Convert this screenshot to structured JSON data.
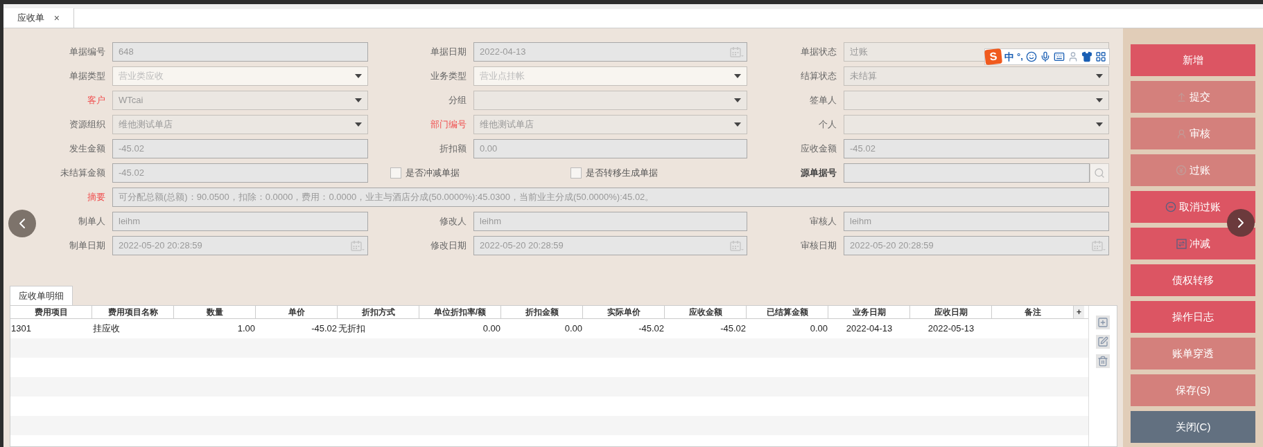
{
  "tab_bar": {
    "tabs": [
      {
        "label": "应收单",
        "selected": true,
        "close": "×"
      }
    ]
  },
  "ime_toolbar": {
    "logo": "S",
    "mode": "中",
    "punctuation": "°,"
  },
  "form": {
    "rows": [
      [
        {
          "kind": "text",
          "label": "单据编号",
          "required": false,
          "value": "648"
        },
        {
          "kind": "date",
          "label": "单据日期",
          "required": false,
          "value": "2022-04-13"
        },
        {
          "kind": "select",
          "label": "单据状态",
          "required": false,
          "editable": false,
          "value": "过账"
        }
      ],
      [
        {
          "kind": "select",
          "label": "单据类型",
          "required": false,
          "editable": true,
          "value": "营业类应收"
        },
        {
          "kind": "select",
          "label": "业务类型",
          "required": false,
          "editable": true,
          "value": "营业点挂帐"
        },
        {
          "kind": "select",
          "label": "结算状态",
          "required": false,
          "editable": false,
          "value": "未结算"
        }
      ],
      [
        {
          "kind": "select",
          "label": "客户",
          "required": true,
          "editable": false,
          "value": "WTcai"
        },
        {
          "kind": "select",
          "label": "分组",
          "required": false,
          "editable": false
        },
        {
          "kind": "select",
          "label": "签单人",
          "required": false,
          "editable": false
        }
      ],
      [
        {
          "kind": "select",
          "label": "资源组织",
          "required": false,
          "editable": false,
          "value": "维他测试单店"
        },
        {
          "kind": "select",
          "label": "部门编号",
          "required": true,
          "editable": false,
          "value": "维他测试单店"
        },
        {
          "kind": "select",
          "label": "个人",
          "required": false,
          "editable": false
        }
      ],
      [
        {
          "kind": "text",
          "label": "发生金额",
          "required": false,
          "value": "-45.02"
        },
        {
          "kind": "text",
          "label": "折扣额",
          "required": false,
          "value": "0.00"
        },
        {
          "kind": "text",
          "label": "应收金额",
          "required": false,
          "value": "-45.02"
        }
      ],
      [
        {
          "kind": "text",
          "label": "未结算金额",
          "required": false,
          "value": "-45.02"
        },
        {
          "kind": "checkbox",
          "label": "是否冲减单据",
          "checked": false
        },
        {
          "kind": "checkbox",
          "label": "是否转移生成单据",
          "checked": false
        },
        {
          "kind": "search",
          "label": "源单据号"
        }
      ],
      [
        {
          "kind": "wide",
          "label": "摘要",
          "required": true,
          "value": "可分配总额(总额)：90.0500，扣除：0.0000，费用：0.0000，业主与酒店分成(50.0000%):45.0300，当前业主分成(50.0000%):45.02。"
        }
      ],
      [
        {
          "kind": "text",
          "label": "制单人",
          "required": false,
          "value": "leihm"
        },
        {
          "kind": "text",
          "label": "修改人",
          "required": false,
          "value": "leihm"
        },
        {
          "kind": "text",
          "label": "审核人",
          "required": false,
          "value": "leihm"
        }
      ],
      [
        {
          "kind": "date",
          "label": "制单日期",
          "required": false,
          "value": "2022-05-20 20:28:59"
        },
        {
          "kind": "date",
          "label": "修改日期",
          "required": false,
          "value": "2022-05-20 20:28:59"
        },
        {
          "kind": "date",
          "label": "审核日期",
          "required": false,
          "value": "2022-05-20 20:28:59"
        }
      ]
    ]
  },
  "detail": {
    "tabs": [
      {
        "label": "应收单明细",
        "selected": true
      }
    ],
    "add_column": "+",
    "columns": [
      {
        "label": "费用项目",
        "kind": "text"
      },
      {
        "label": "费用项目名称",
        "kind": "text"
      },
      {
        "label": "数量",
        "kind": "number"
      },
      {
        "label": "单价",
        "kind": "number"
      },
      {
        "label": "折扣方式",
        "kind": "text"
      },
      {
        "label": "单位折扣率/额",
        "kind": "number"
      },
      {
        "label": "折扣金额",
        "kind": "number"
      },
      {
        "label": "实际单价",
        "kind": "number"
      },
      {
        "label": "应收金额",
        "kind": "number"
      },
      {
        "label": "已结算金额",
        "kind": "number"
      },
      {
        "label": "业务日期",
        "kind": "date"
      },
      {
        "label": "应收日期",
        "kind": "date"
      },
      {
        "label": "备注"
      }
    ],
    "rows": [
      {
        "cells": [
          "1301",
          "挂应收",
          "1.00",
          "-45.02",
          "无折扣",
          "0.00",
          "0.00",
          "-45.02",
          "-45.02",
          "0.00",
          "2022-04-13",
          "2022-05-13"
        ]
      }
    ]
  },
  "buttons": [
    {
      "label": "新增",
      "kind": "plain",
      "disabled": false
    },
    {
      "label": "提交",
      "kind": "submit",
      "disabled": true
    },
    {
      "label": "审核",
      "kind": "audit",
      "disabled": true
    },
    {
      "label": "过账",
      "kind": "post",
      "disabled": true
    },
    {
      "label": "取消过账",
      "kind": "unpost",
      "disabled": false
    },
    {
      "label": "冲减",
      "kind": "offset",
      "disabled": false
    },
    {
      "label": "债权转移",
      "kind": "plain",
      "disabled": false
    },
    {
      "label": "操作日志",
      "kind": "plain",
      "disabled": false
    },
    {
      "label": "账单穿透",
      "kind": "plain",
      "disabled": true
    },
    {
      "label": "保存(S)",
      "kind": "plain",
      "disabled": true
    },
    {
      "label": "关闭(C)",
      "kind": "close",
      "disabled": false
    }
  ]
}
